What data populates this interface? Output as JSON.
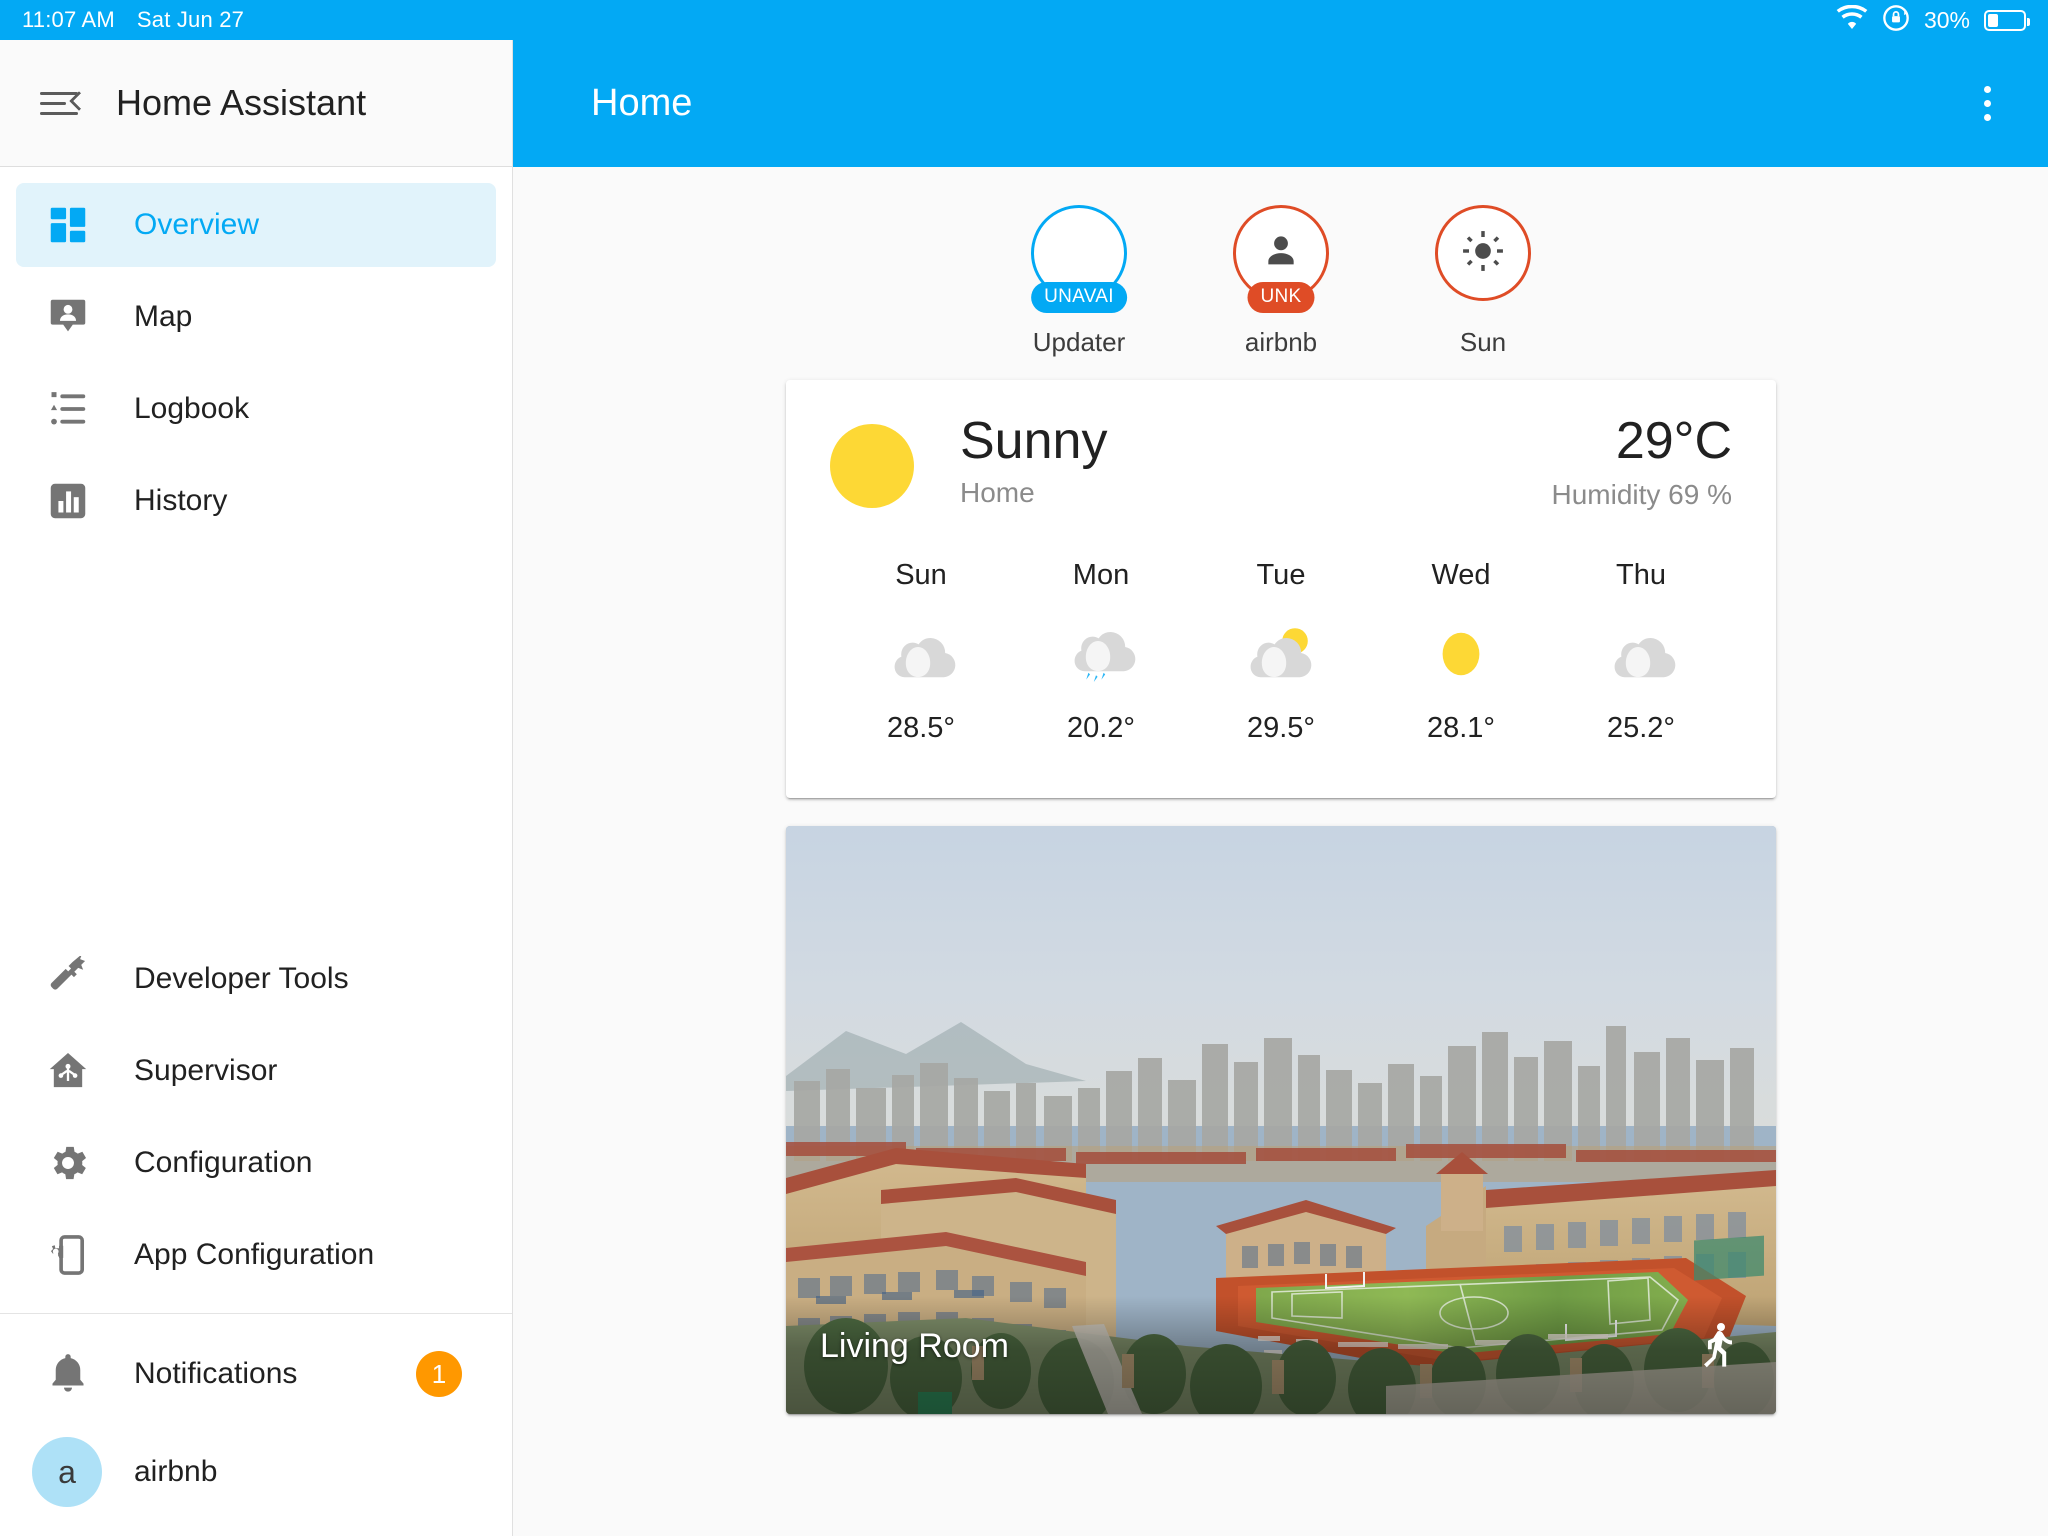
{
  "status_bar": {
    "time": "11:07 AM",
    "date": "Sat Jun 27",
    "battery_percent": "30%",
    "icons": [
      "wifi-icon",
      "rotation-lock-icon",
      "battery-icon"
    ]
  },
  "sidebar": {
    "title": "Home Assistant",
    "menu_icon": "menu-collapse-icon",
    "primary_items": [
      {
        "label": "Overview",
        "icon": "view-dashboard-icon",
        "active": true
      },
      {
        "label": "Map",
        "icon": "map-marker-account-icon",
        "active": false
      },
      {
        "label": "Logbook",
        "icon": "format-list-bulleted-icon",
        "active": false
      },
      {
        "label": "History",
        "icon": "chart-box-icon",
        "active": false
      }
    ],
    "secondary_items": [
      {
        "label": "Developer Tools",
        "icon": "hammer-icon"
      },
      {
        "label": "Supervisor",
        "icon": "home-assistant-supervisor-icon"
      },
      {
        "label": "Configuration",
        "icon": "cog-icon"
      },
      {
        "label": "App Configuration",
        "icon": "cellphone-cog-icon"
      }
    ],
    "notifications": {
      "label": "Notifications",
      "icon": "bell-icon",
      "count": "1"
    },
    "user": {
      "label": "airbnb",
      "avatar_initial": "a"
    }
  },
  "header": {
    "title": "Home",
    "overflow_icon": "dots-vertical-icon"
  },
  "badges": [
    {
      "name": "Updater",
      "state": "UNAVAI",
      "color": "#03A9F4",
      "icon": "none"
    },
    {
      "name": "airbnb",
      "state": "UNK",
      "color": "#DF4C26",
      "icon": "account-icon"
    },
    {
      "name": "Sun",
      "state": "",
      "color": "#DF4C26",
      "icon": "weather-sunny-icon"
    }
  ],
  "weather_card": {
    "condition": "Sunny",
    "location": "Home",
    "temperature": "29°C",
    "humidity": "Humidity 69 %",
    "condition_icon": "weather-sunny-icon",
    "forecast": [
      {
        "day": "Sun",
        "icon": "cloudy",
        "temp": "28.5°"
      },
      {
        "day": "Mon",
        "icon": "rainy",
        "temp": "20.2°"
      },
      {
        "day": "Tue",
        "icon": "partlycloudy",
        "temp": "29.5°"
      },
      {
        "day": "Wed",
        "icon": "sunny",
        "temp": "28.1°"
      },
      {
        "day": "Thu",
        "icon": "cloudy",
        "temp": "25.2°"
      }
    ]
  },
  "camera_card": {
    "name": "Living Room",
    "motion_icon": "run-icon"
  },
  "colors": {
    "accent": "#03A9F4",
    "sidebar_active_bg": "#E1F3FB",
    "badge_warning": "#DF4C26",
    "notification_badge": "#FF9800",
    "sun_yellow": "#FDD835",
    "content_bg": "#FAFAFA"
  }
}
